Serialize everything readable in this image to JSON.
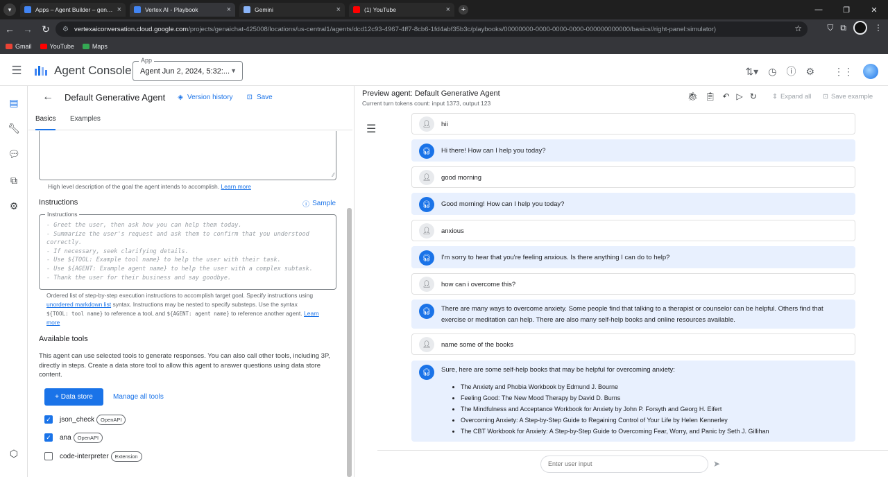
{
  "browser": {
    "tabs": [
      {
        "title": "Apps – Agent Builder – genAich",
        "color": "#4285f4",
        "active": false
      },
      {
        "title": "Vertex AI - Playbook",
        "color": "#4285f4",
        "active": true
      },
      {
        "title": "Gemini",
        "color": "#8ab4f8",
        "active": false
      },
      {
        "title": "(1) YouTube",
        "color": "#ff0000",
        "active": false
      }
    ],
    "url_domain": "vertexaiconversation.cloud.google.com",
    "url_path": "/projects/genaichat-425008/locations/us-central1/agents/dcd12c93-4967-4ff7-8cb6-1fd4abf35b3c/playbooks/00000000-0000-0000-0000-000000000000/basics//right-panel:simulator)",
    "bookmarks": [
      {
        "label": "Gmail",
        "color": "#ea4335"
      },
      {
        "label": "YouTube",
        "color": "#ff0000"
      },
      {
        "label": "Maps",
        "color": "#34a853"
      }
    ]
  },
  "header": {
    "app_title": "Agent Console",
    "app_select_label": "App",
    "app_select_value": "Agent Jun 2, 2024, 5:32:..."
  },
  "editor": {
    "title": "Default Generative Agent",
    "version_history": "Version history",
    "save": "Save",
    "tabs": [
      "Basics",
      "Examples"
    ],
    "goal_hint": "High level description of the goal the agent intends to accomplish.",
    "learn_more": "Learn more",
    "instructions_title": "Instructions",
    "sample": "Sample",
    "instructions_label": "Instructions",
    "instructions_placeholder": "- Greet the user, then ask how you can help them today.\n- Summarize the user's request and ask them to confirm that you understood\ncorrectly.\n- If necessary, seek clarifying details.\n- Use ${TOOL: Example tool name} to help the user with their task.\n- Use ${AGENT: Example agent name} to help the user with a complex subtask.\n- Thank the user for their business and say goodbye.",
    "instr_hint_1": "Ordered list of step-by-step execution instructions to accomplish target goal. Specify instructions using",
    "instr_hint_link": "unordered markdown list",
    "instr_hint_2": " syntax. Instructions may be nested to specify substeps. Use the syntax",
    "instr_hint_3a": "${TOOL: tool name}",
    "instr_hint_3b": " to reference a tool, and ",
    "instr_hint_3c": "${AGENT: agent name}",
    "instr_hint_3d": " to reference another agent. ",
    "instr_learn": "Learn",
    "instr_more": "more",
    "tools_title": "Available tools",
    "tools_desc": "This agent can use selected tools to generate responses. You can also call other tools, including 3P, directly in steps. Create a data store tool to allow this agent to answer questions using data store content.",
    "btn_data_store": "+ Data store",
    "manage_tools": "Manage all tools",
    "tools": [
      {
        "name": "json_check",
        "type": "OpenAPI",
        "checked": true
      },
      {
        "name": "ana",
        "type": "OpenAPI",
        "checked": true
      },
      {
        "name": "code-interpreter",
        "type": "Extension",
        "checked": false
      }
    ]
  },
  "preview": {
    "title": "Preview agent: Default Generative Agent",
    "tokens": "Current turn tokens count: input 1373, output 123",
    "expand_all": "Expand all",
    "save_example": "Save example",
    "input_placeholder": "Enter user input",
    "messages": [
      {
        "role": "user",
        "text": "hii"
      },
      {
        "role": "bot",
        "text": "Hi there! How can I help you today?"
      },
      {
        "role": "user",
        "text": "good morning"
      },
      {
        "role": "bot",
        "text": "Good morning! How can I help you today?"
      },
      {
        "role": "user",
        "text": "anxious"
      },
      {
        "role": "bot",
        "text": "I'm sorry to hear that you're feeling anxious. Is there anything I can do to help?"
      },
      {
        "role": "user",
        "text": "how can i overcome this?"
      },
      {
        "role": "bot",
        "text": "There are many ways to overcome anxiety. Some people find that talking to a therapist or counselor can be helpful. Others find that exercise or meditation can help. There are also many self-help books and online resources available."
      },
      {
        "role": "user",
        "text": "name some of the books"
      },
      {
        "role": "bot",
        "text": "Sure, here are some self-help books that may be helpful for overcoming anxiety:"
      }
    ],
    "books": [
      "The Anxiety and Phobia Workbook by Edmund J. Bourne",
      "Feeling Good: The New Mood Therapy by David D. Burns",
      "The Mindfulness and Acceptance Workbook for Anxiety by John P. Forsyth and Georg H. Eifert",
      "Overcoming Anxiety: A Step-by-Step Guide to Regaining Control of Your Life by Helen Kennerley",
      "The CBT Workbook for Anxiety: A Step-by-Step Guide to Overcoming Fear, Worry, and Panic by Seth J. Gillihan"
    ]
  }
}
